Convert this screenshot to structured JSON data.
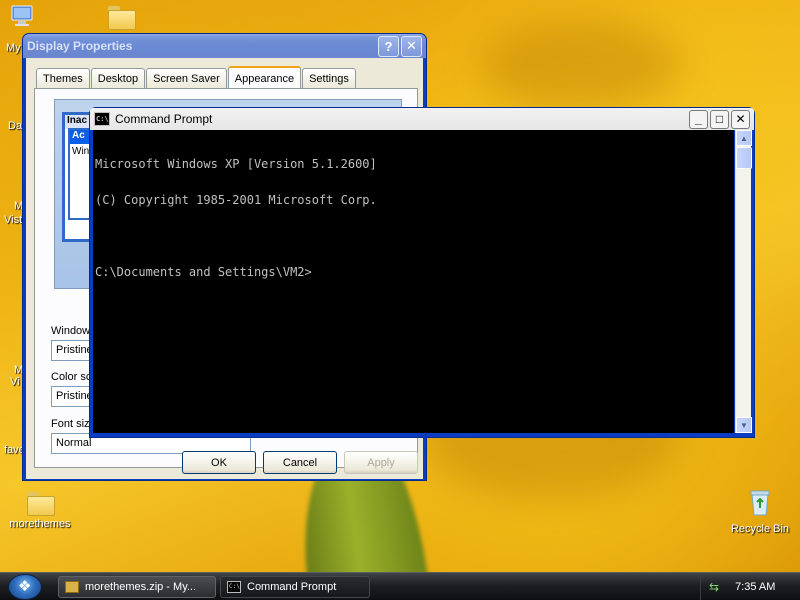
{
  "desktop": {
    "icons": [
      {
        "label": "My",
        "name": "my-computer"
      },
      {
        "label": "",
        "name": "folder"
      },
      {
        "label": "morethemes",
        "name": "morethemes"
      },
      {
        "label": "Recycle Bin",
        "name": "recycle-bin"
      }
    ],
    "edge_labels": [
      "Da",
      "M",
      "Vist",
      "M",
      "Vi",
      "fave"
    ]
  },
  "display_properties": {
    "title": "Display Properties",
    "tabs": [
      "Themes",
      "Desktop",
      "Screen Saver",
      "Appearance",
      "Settings"
    ],
    "active_tab": "Appearance",
    "preview": {
      "inactive_title": "Inac",
      "active_title": "Ac",
      "body_text": "Win"
    },
    "fields": [
      {
        "label": "Windows",
        "value": "Pristine"
      },
      {
        "label": "Color sch",
        "value": "Pristine"
      },
      {
        "label": "Font size",
        "value": "Normal"
      }
    ],
    "buttons": {
      "ok": "OK",
      "cancel": "Cancel",
      "apply": "Apply"
    },
    "title_buttons": {
      "help": "?",
      "close": "✕"
    }
  },
  "command_prompt": {
    "title": "Command Prompt",
    "icon_text": "C:\\",
    "lines": [
      "Microsoft Windows XP [Version 5.1.2600]",
      "(C) Copyright 1985-2001 Microsoft Corp.",
      "",
      "C:\\Documents and Settings\\VM2>"
    ],
    "title_buttons": {
      "minimize": "_",
      "maximize": "□",
      "close": "✕"
    }
  },
  "taskbar": {
    "items": [
      {
        "label": "morethemes.zip - My...",
        "icon": "zip-folder-icon",
        "active": false
      },
      {
        "label": "Command Prompt",
        "icon": "cmd-icon",
        "active": true
      }
    ],
    "clock": "7:35 AM"
  }
}
